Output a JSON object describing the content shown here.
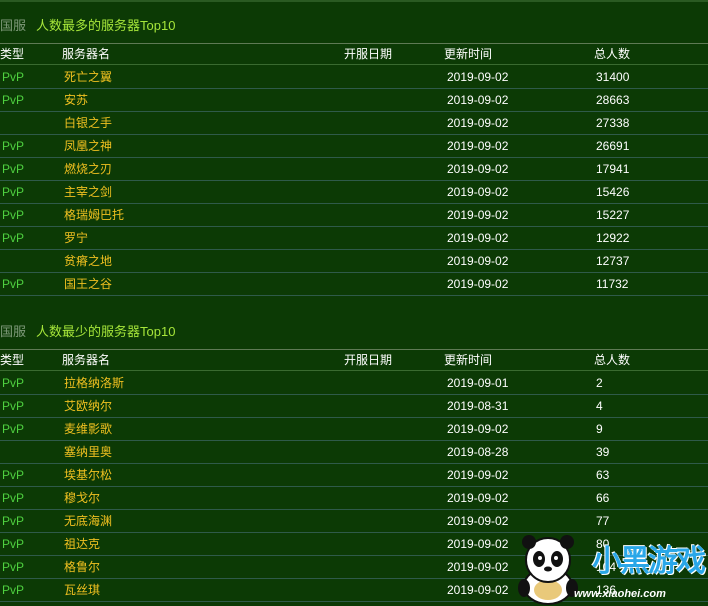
{
  "tables": [
    {
      "region": "国服",
      "title": "人数最多的服务器Top10",
      "headers": {
        "type": "类型",
        "name": "服务器名",
        "open_date": "开服日期",
        "update_time": "更新时间",
        "total": "总人数"
      },
      "rows": [
        {
          "type": "PvP",
          "name": "死亡之翼",
          "open_date": "",
          "update_time": "2019-09-02",
          "total": "31400"
        },
        {
          "type": "PvP",
          "name": "安苏",
          "open_date": "",
          "update_time": "2019-09-02",
          "total": "28663"
        },
        {
          "type": "",
          "name": "白银之手",
          "open_date": "",
          "update_time": "2019-09-02",
          "total": "27338"
        },
        {
          "type": "PvP",
          "name": "凤凰之神",
          "open_date": "",
          "update_time": "2019-09-02",
          "total": "26691"
        },
        {
          "type": "PvP",
          "name": "燃烧之刃",
          "open_date": "",
          "update_time": "2019-09-02",
          "total": "17941"
        },
        {
          "type": "PvP",
          "name": "主宰之剑",
          "open_date": "",
          "update_time": "2019-09-02",
          "total": "15426"
        },
        {
          "type": "PvP",
          "name": "格瑞姆巴托",
          "open_date": "",
          "update_time": "2019-09-02",
          "total": "15227"
        },
        {
          "type": "PvP",
          "name": "罗宁",
          "open_date": "",
          "update_time": "2019-09-02",
          "total": "12922"
        },
        {
          "type": "",
          "name": "贫瘠之地",
          "open_date": "",
          "update_time": "2019-09-02",
          "total": "12737"
        },
        {
          "type": "PvP",
          "name": "国王之谷",
          "open_date": "",
          "update_time": "2019-09-02",
          "total": "11732"
        }
      ]
    },
    {
      "region": "国服",
      "title": "人数最少的服务器Top10",
      "headers": {
        "type": "类型",
        "name": "服务器名",
        "open_date": "开服日期",
        "update_time": "更新时间",
        "total": "总人数"
      },
      "rows": [
        {
          "type": "PvP",
          "name": "拉格纳洛斯",
          "open_date": "",
          "update_time": "2019-09-01",
          "total": "2"
        },
        {
          "type": "PvP",
          "name": "艾欧纳尔",
          "open_date": "",
          "update_time": "2019-08-31",
          "total": "4"
        },
        {
          "type": "PvP",
          "name": "麦维影歌",
          "open_date": "",
          "update_time": "2019-09-02",
          "total": "9"
        },
        {
          "type": "",
          "name": "塞纳里奥",
          "open_date": "",
          "update_time": "2019-08-28",
          "total": "39"
        },
        {
          "type": "PvP",
          "name": "埃基尔松",
          "open_date": "",
          "update_time": "2019-09-02",
          "total": "63"
        },
        {
          "type": "PvP",
          "name": "穆戈尔",
          "open_date": "",
          "update_time": "2019-09-02",
          "total": "66"
        },
        {
          "type": "PvP",
          "name": "无底海渊",
          "open_date": "",
          "update_time": "2019-09-02",
          "total": "77"
        },
        {
          "type": "PvP",
          "name": "祖达克",
          "open_date": "",
          "update_time": "2019-09-02",
          "total": "80"
        },
        {
          "type": "PvP",
          "name": "格鲁尔",
          "open_date": "",
          "update_time": "2019-09-02",
          "total": "104"
        },
        {
          "type": "PvP",
          "name": "瓦丝琪",
          "open_date": "",
          "update_time": "2019-09-02",
          "total": "136"
        }
      ]
    }
  ],
  "watermark": {
    "brand": "小黑游戏",
    "url": "www.xiaohei.com",
    "icon": "panda-mascot-icon"
  }
}
